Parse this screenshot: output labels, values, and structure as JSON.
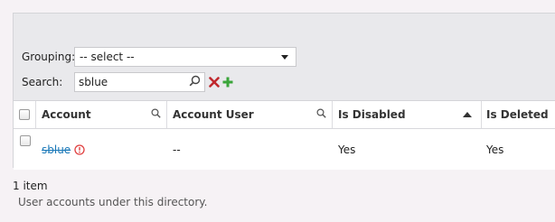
{
  "filters": {
    "grouping_label": "Grouping:",
    "grouping_value": "-- select --",
    "search_label": "Search:",
    "search_value": "sblue"
  },
  "grid": {
    "columns": [
      "Account",
      "Account User",
      "Is Disabled",
      "Is Deleted"
    ],
    "rows": [
      {
        "account": "sblue",
        "account_user": "--",
        "is_disabled": "Yes",
        "is_deleted": "Yes"
      }
    ]
  },
  "footer": {
    "count": "1 item",
    "description": "User accounts under this directory."
  },
  "colors": {
    "link": "#1a78b8",
    "clear": "#c0282d",
    "add": "#3aa53a",
    "warning": "#e04040"
  },
  "icons": [
    "search-icon",
    "clear-icon",
    "add-icon",
    "warning-icon",
    "sort-ascending-icon"
  ]
}
